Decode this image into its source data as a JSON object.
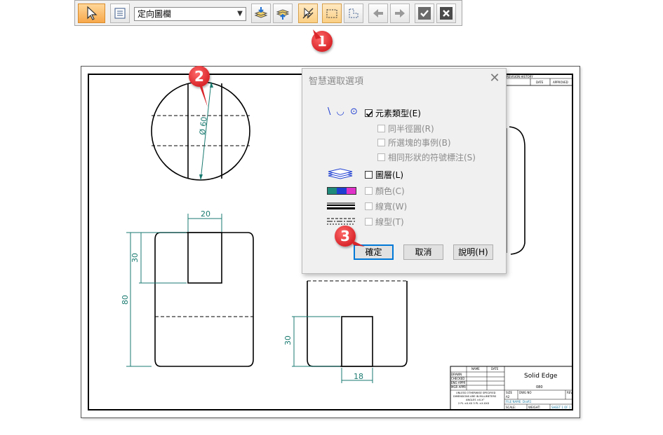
{
  "toolbar": {
    "select_mode": "定向圖欄",
    "buttons": [
      "select-arrow-icon",
      "properties-icon",
      "layers-add-icon",
      "layers-up-icon",
      "smart-select-icon",
      "rect-select-icon",
      "lasso-select-icon",
      "back-arrow-icon",
      "forward-arrow-icon",
      "accept-check-icon",
      "cancel-x-icon"
    ]
  },
  "badges": {
    "b1": "1",
    "b2": "2",
    "b3": "3"
  },
  "drawing": {
    "dim_diameter": "Ø 60",
    "dim_20": "20",
    "dim_30_left": "30",
    "dim_80": "80",
    "dim_30_right": "30",
    "dim_18": "18",
    "title_block": {
      "company": "Solid Edge",
      "name": "NAME",
      "date": "DATE",
      "drawn": "DRAWN",
      "checked": "CHECKED",
      "eng_appr": "ENG APPR",
      "mgr_appr": "MGR APPR",
      "notes_1": "UNLESS OTHERWISE SPECIFIED",
      "notes_2": "DIMENSIONS ARE IN MILLIMETERS",
      "notes_3": "ANGLES ±X.X°",
      "notes_4": "2 PL ±X.XX 3 PL ±X.XXX",
      "size": "SIZE",
      "size_val": "A2",
      "dwg_no": "DWG NO",
      "rev": "REV",
      "file_name": "FILE NAME: Draft1",
      "scale": "SCALE:",
      "weight": "WEIGHT:",
      "sheet": "SHEET 1 OF 1",
      "number": "080",
      "revision_hdr": "REVISION HISTORY",
      "rev_date": "DATE",
      "rev_approved": "APPROVED"
    }
  },
  "dialog": {
    "title": "智慧選取選項",
    "element_type": "元素類型(E)",
    "same_radius": "同半徑圓(R)",
    "selected_instances": "所選塊的事例(B)",
    "same_shape_symbol": "相同形狀的符號標注(S)",
    "layer": "圖層(L)",
    "color": "顏色(C)",
    "line_width": "線寬(W)",
    "line_type": "線型(T)",
    "ok": "確定",
    "cancel": "取消",
    "help": "說明(H)",
    "element_icons": "\\ ◡ ⊙",
    "layer_colors": [
      "#1e8a7a",
      "#1f3fd1",
      "#e032c8"
    ]
  }
}
